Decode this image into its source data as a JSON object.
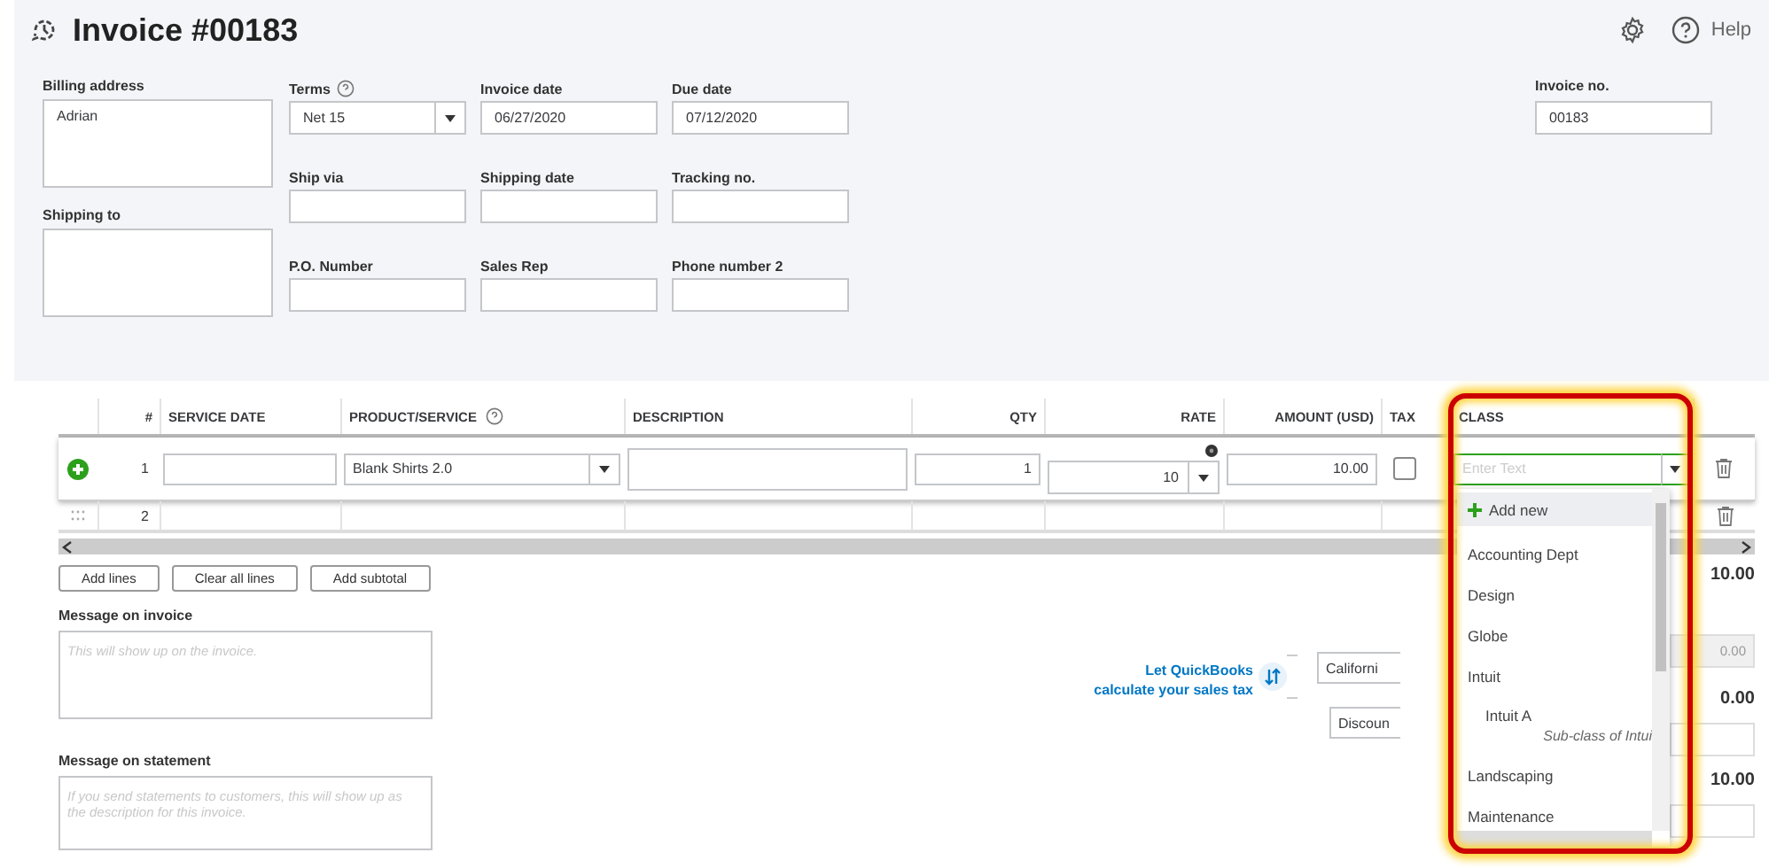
{
  "header": {
    "title": "Invoice #00183",
    "help": "Help"
  },
  "billing_address": {
    "label": "Billing address",
    "value": "Adrian"
  },
  "shipping_to": {
    "label": "Shipping to"
  },
  "fields": [
    {
      "label": "Terms",
      "kind": "select",
      "value": "Net 15",
      "help": true
    },
    {
      "label": "Invoice date",
      "kind": "input",
      "value": "06/27/2020"
    },
    {
      "label": "Due date",
      "kind": "input",
      "value": "07/12/2020"
    },
    {
      "label": "Ship via",
      "kind": "input"
    },
    {
      "label": "Shipping date",
      "kind": "input"
    },
    {
      "label": "Tracking no.",
      "kind": "input"
    },
    {
      "label": "P.O. Number",
      "kind": "input"
    },
    {
      "label": "Sales Rep",
      "kind": "input"
    },
    {
      "label": "Phone number 2",
      "kind": "input"
    }
  ],
  "invoice_no": {
    "label": "Invoice no.",
    "value": "00183"
  },
  "table": {
    "columns": [
      {
        "label": "#"
      },
      {
        "label": "SERVICE DATE"
      },
      {
        "label": "PRODUCT/SERVICE",
        "help": true
      },
      {
        "label": "DESCRIPTION"
      },
      {
        "label": "QTY"
      },
      {
        "label": "RATE"
      },
      {
        "label": "AMOUNT (USD)"
      },
      {
        "label": "TAX"
      },
      {
        "label": "CLASS"
      }
    ],
    "rows": [
      {
        "kind": "editing",
        "number": "1",
        "product": "Blank Shirts 2.0",
        "qty": "1",
        "rate": "10",
        "amount": "10.00",
        "tax": false,
        "class_placeholder": "Enter Text"
      },
      {
        "kind": "plain",
        "number": "2"
      }
    ]
  },
  "class_dropdown": {
    "items": [
      {
        "label": "Add new",
        "kind": "add",
        "selected": true
      },
      {
        "label": "Accounting Dept",
        "kind": "class",
        "selected": false
      },
      {
        "label": "Design",
        "kind": "class",
        "selected": false
      },
      {
        "label": "Globe",
        "kind": "class",
        "selected": false
      },
      {
        "label": "Intuit",
        "kind": "class",
        "selected": false,
        "children": [
          {
            "label": "Intuit A",
            "note": "Sub-class of Intui",
            "selected": false
          }
        ]
      },
      {
        "label": "Landscaping",
        "kind": "class",
        "selected": false
      },
      {
        "label": "Maintenance",
        "kind": "class",
        "selected": false
      }
    ]
  },
  "buttons": [
    "Add lines",
    "Clear all lines",
    "Add subtotal"
  ],
  "message_invoice": {
    "label": "Message on invoice",
    "placeholder": "This will show up on the invoice."
  },
  "message_statement": {
    "label": "Message on statement",
    "placeholder": "If you send statements to customers, this will show up as the description for this invoice."
  },
  "totals": {
    "subtotal": "10.00",
    "sales_tax_link": "Let QuickBooks calculate your sales tax",
    "tax_rate_select": "Californi",
    "tax_amount": "0.00",
    "discount_select": "Discoun",
    "discount_amount": "0.00",
    "total": "10.00"
  }
}
